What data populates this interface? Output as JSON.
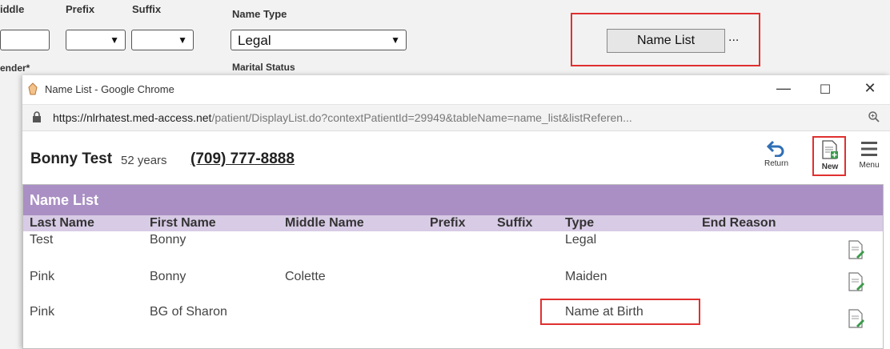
{
  "form": {
    "middle_label": "iddle",
    "prefix_label": "Prefix",
    "suffix_label": "Suffix",
    "name_type_label": "Name Type",
    "name_type_value": "Legal",
    "marital_status_label": "Marital Status",
    "gender_label": "ender*",
    "name_list_button": "Name List",
    "ellipsis": "..."
  },
  "popup": {
    "window_title": "Name List - Google Chrome",
    "url_host": "https://nlrhatest.med-access.net",
    "url_path": "/patient/DisplayList.do?contextPatientId=29949&tableName=name_list&listReferen...",
    "patient_name": "Bonny Test",
    "patient_age": "52 years",
    "patient_phone": "(709) 777-8888",
    "toolbar": {
      "return_label": "Return",
      "new_label": "New",
      "menu_label": "Menu"
    },
    "panel_title": "Name List",
    "columns": [
      "Last Name",
      "First Name",
      "Middle Name",
      "Prefix",
      "Suffix",
      "Type",
      "End Reason"
    ],
    "rows": [
      {
        "last": "Test",
        "first": "Bonny",
        "middle": "",
        "prefix": "",
        "suffix": "",
        "type": "Legal",
        "end_reason": ""
      },
      {
        "last": "Pink",
        "first": "Bonny",
        "middle": "Colette",
        "prefix": "",
        "suffix": "",
        "type": "Maiden",
        "end_reason": ""
      },
      {
        "last": "Pink",
        "first": "BG of Sharon",
        "middle": "",
        "prefix": "",
        "suffix": "",
        "type": "Name at Birth",
        "end_reason": ""
      }
    ]
  },
  "colors": {
    "highlight": "#e03030",
    "panel_header": "#a98fc3",
    "column_header": "#d8cbe6",
    "return_icon": "#2f6fb5",
    "new_icon": "#3a9a4a"
  },
  "icons": [
    "dropdown-caret-icon",
    "chrome-app-icon",
    "minimize-icon",
    "maximize-icon",
    "close-icon",
    "lock-icon",
    "zoom-icon",
    "return-arrow-icon",
    "new-document-icon",
    "menu-hamburger-icon",
    "edit-document-icon"
  ]
}
